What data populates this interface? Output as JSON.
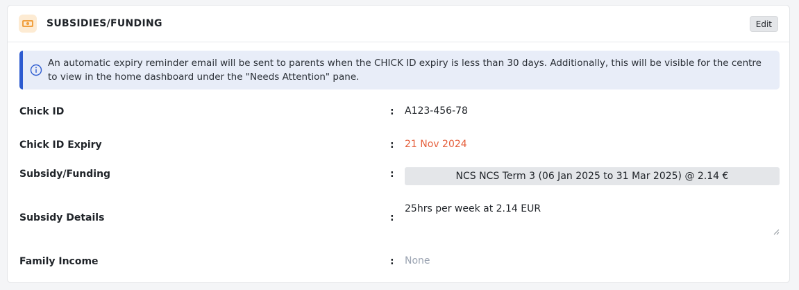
{
  "header": {
    "title": "SUBSIDIES/FUNDING",
    "icon": "money-icon",
    "edit_label": "Edit"
  },
  "info": {
    "icon": "info-icon",
    "text": "An automatic expiry reminder email will be sent to parents when the CHICK ID expiry is less than 30 days. Additionally, this will be visible for the centre to view in the home dashboard under the \"Needs Attention\" pane."
  },
  "fields": {
    "chick_id": {
      "label": "Chick ID",
      "value": "A123-456-78"
    },
    "chick_id_expiry": {
      "label": "Chick ID Expiry",
      "value": "21 Nov 2024"
    },
    "subsidy_funding": {
      "label": "Subsidy/Funding",
      "value": "NCS NCS Term 3 (06 Jan 2025 to 31 Mar 2025) @ 2.14 €"
    },
    "subsidy_details": {
      "label": "Subsidy Details",
      "value": "25hrs per week at 2.14 EUR"
    },
    "family_income": {
      "label": "Family Income",
      "value": "None"
    }
  },
  "separator": ":",
  "colors": {
    "accent": "#2d5bd0",
    "info_bg": "#e8edf8",
    "expiry": "#e5603d",
    "muted": "#9aa3b1",
    "icon_bg": "#fdebd3",
    "icon_fg": "#f0a040"
  }
}
